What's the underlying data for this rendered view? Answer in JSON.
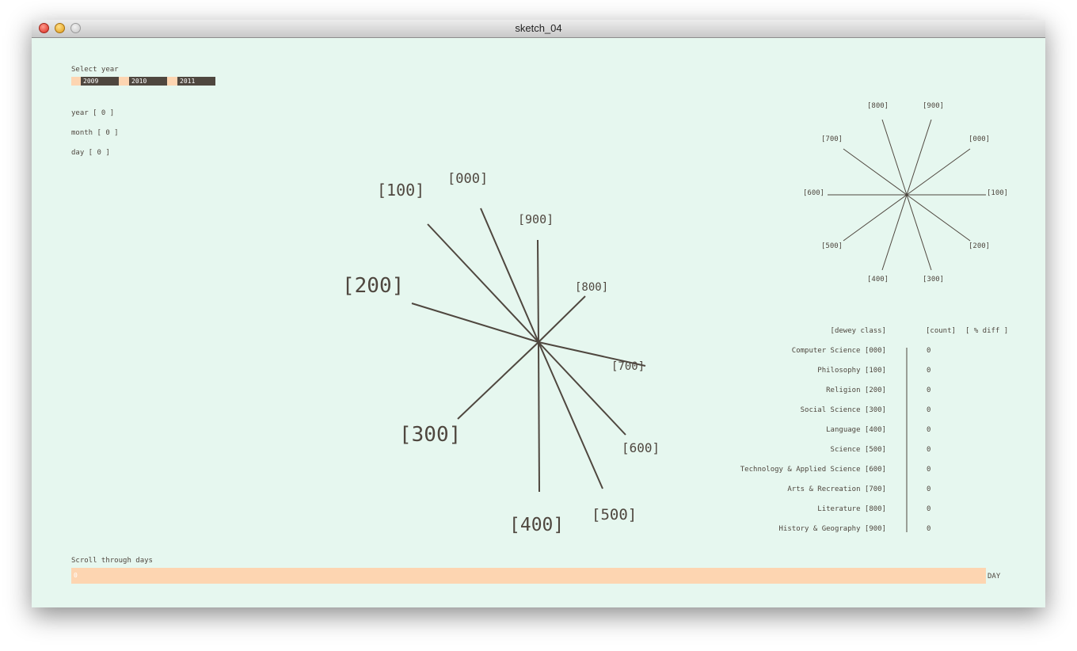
{
  "window": {
    "title": "sketch_04"
  },
  "year_selector": {
    "label": "Select year",
    "years": [
      "2009",
      "2010",
      "2011"
    ]
  },
  "date_readout": {
    "year": "year [ 0 ]",
    "month": "month [ 0 ]",
    "day": "day [ 0 ]"
  },
  "main_radial": {
    "labels": [
      "[000]",
      "[100]",
      "[200]",
      "[300]",
      "[400]",
      "[500]",
      "[600]",
      "[700]",
      "[800]",
      "[900]"
    ]
  },
  "mini_radial": {
    "labels": [
      "[000]",
      "[100]",
      "[200]",
      "[300]",
      "[400]",
      "[500]",
      "[600]",
      "[700]",
      "[800]",
      "[900]"
    ]
  },
  "table": {
    "headers": {
      "class": "[dewey class]",
      "count": "[count]",
      "diff": "[ % diff ]"
    },
    "rows": [
      {
        "label": "Computer Science  [000]",
        "count": "0"
      },
      {
        "label": "Philosophy  [100]",
        "count": "0"
      },
      {
        "label": "Religion  [200]",
        "count": "0"
      },
      {
        "label": "Social Science  [300]",
        "count": "0"
      },
      {
        "label": "Language  [400]",
        "count": "0"
      },
      {
        "label": "Science  [500]",
        "count": "0"
      },
      {
        "label": "Technology & Applied Science  [600]",
        "count": "0"
      },
      {
        "label": "Arts & Recreation  [700]",
        "count": "0"
      },
      {
        "label": "Literature  [800]",
        "count": "0"
      },
      {
        "label": "History & Geography  [900]",
        "count": "0"
      }
    ]
  },
  "day_scroller": {
    "label": "Scroll through days",
    "value": "0",
    "unit": "DAY"
  },
  "colors": {
    "background": "#e6f7ef",
    "ink": "#4f473f",
    "accent": "#fdd5b1"
  }
}
